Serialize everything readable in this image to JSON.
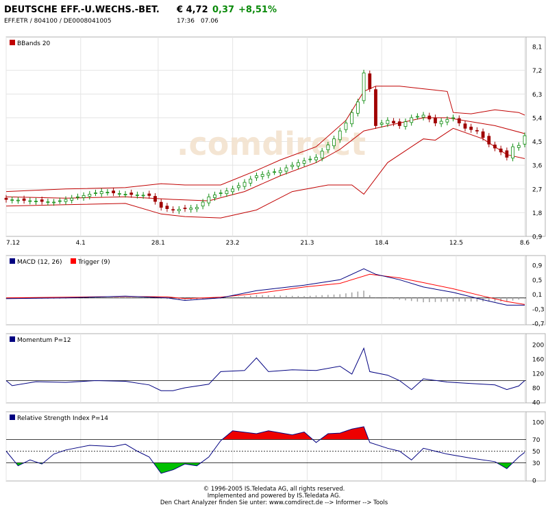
{
  "header": {
    "title": "DEUTSCHE EFF.-U.WECHS.-BET.",
    "price": "€ 4,72",
    "change": "0,37",
    "change_pct": "+8,51%",
    "ids": "EFF.ETR  /  804100  /  DE0008041005",
    "time": "17:36",
    "date": "07.06"
  },
  "colors": {
    "up_candle": "#0a8a0a",
    "down_candle": "#a00000",
    "bands": "#c00000",
    "macd": "#000080",
    "trigger": "#ff0000",
    "momentum": "#000080",
    "rsi": "#000080",
    "rsi_overbought": "#ee0000",
    "rsi_oversold": "#00c000",
    "panel_border": "#b0b0b0",
    "grid": "#e4e4e4"
  },
  "footer": {
    "line1": "© 1996-2005 IS.Teledata AG, all rights reserved.",
    "line2": "Implemented and powered by IS.Teledata AG.",
    "line3": "Den Chart Analyzer finden Sie unter: www.comdirect.de --> Informer --> Tools"
  },
  "watermark": ".comdirect",
  "chart_data": [
    {
      "type": "candlestick",
      "title": "BBands 20",
      "x_ticks": [
        "7.12",
        "4.1",
        "28.1",
        "23.2",
        "21.3",
        "18.4",
        "12.5",
        "8.6"
      ],
      "ylim": [
        0.9,
        8.1
      ],
      "y_ticks": [
        "8,1",
        "7,2",
        "6,3",
        "5,4",
        "4,5",
        "3,6",
        "2,7",
        "1,8",
        "0,9"
      ],
      "close_points": [
        {
          "x": 0,
          "y": 2.3
        },
        {
          "x": 4,
          "y": 2.25
        },
        {
          "x": 8,
          "y": 2.2
        },
        {
          "x": 12,
          "y": 2.4
        },
        {
          "x": 16,
          "y": 2.6
        },
        {
          "x": 20,
          "y": 2.5
        },
        {
          "x": 24,
          "y": 2.45
        },
        {
          "x": 26,
          "y": 2.0
        },
        {
          "x": 28,
          "y": 1.9
        },
        {
          "x": 32,
          "y": 2.0
        },
        {
          "x": 34,
          "y": 2.4
        },
        {
          "x": 38,
          "y": 2.7
        },
        {
          "x": 42,
          "y": 3.2
        },
        {
          "x": 46,
          "y": 3.4
        },
        {
          "x": 49,
          "y": 3.7
        },
        {
          "x": 52,
          "y": 3.9
        },
        {
          "x": 55,
          "y": 4.6
        },
        {
          "x": 57,
          "y": 5.2
        },
        {
          "x": 59,
          "y": 6.0
        },
        {
          "x": 60,
          "y": 7.1
        },
        {
          "x": 61,
          "y": 6.5
        },
        {
          "x": 62,
          "y": 5.1
        },
        {
          "x": 64,
          "y": 5.3
        },
        {
          "x": 66,
          "y": 5.1
        },
        {
          "x": 68,
          "y": 5.4
        },
        {
          "x": 70,
          "y": 5.5
        },
        {
          "x": 72,
          "y": 5.2
        },
        {
          "x": 75,
          "y": 5.4
        },
        {
          "x": 77,
          "y": 5.0
        },
        {
          "x": 79,
          "y": 4.9
        },
        {
          "x": 81,
          "y": 4.4
        },
        {
          "x": 83,
          "y": 4.1
        },
        {
          "x": 84,
          "y": 3.9
        },
        {
          "x": 85,
          "y": 4.3
        },
        {
          "x": 86,
          "y": 4.35
        },
        {
          "x": 87,
          "y": 4.72
        }
      ],
      "bband_upper": [
        {
          "x": 0,
          "y": 2.6
        },
        {
          "x": 10,
          "y": 2.7
        },
        {
          "x": 20,
          "y": 2.75
        },
        {
          "x": 26,
          "y": 2.9
        },
        {
          "x": 30,
          "y": 2.85
        },
        {
          "x": 36,
          "y": 2.85
        },
        {
          "x": 42,
          "y": 3.4
        },
        {
          "x": 46,
          "y": 3.8
        },
        {
          "x": 52,
          "y": 4.3
        },
        {
          "x": 57,
          "y": 5.3
        },
        {
          "x": 60,
          "y": 6.4
        },
        {
          "x": 62,
          "y": 6.6
        },
        {
          "x": 66,
          "y": 6.6
        },
        {
          "x": 70,
          "y": 6.5
        },
        {
          "x": 74,
          "y": 6.4
        },
        {
          "x": 75,
          "y": 5.6
        },
        {
          "x": 78,
          "y": 5.55
        },
        {
          "x": 82,
          "y": 5.7
        },
        {
          "x": 86,
          "y": 5.6
        },
        {
          "x": 87,
          "y": 5.5
        }
      ],
      "bband_middle": [
        {
          "x": 0,
          "y": 2.4
        },
        {
          "x": 10,
          "y": 2.35
        },
        {
          "x": 20,
          "y": 2.4
        },
        {
          "x": 28,
          "y": 2.3
        },
        {
          "x": 34,
          "y": 2.25
        },
        {
          "x": 40,
          "y": 2.6
        },
        {
          "x": 46,
          "y": 3.2
        },
        {
          "x": 52,
          "y": 3.7
        },
        {
          "x": 56,
          "y": 4.2
        },
        {
          "x": 60,
          "y": 4.9
        },
        {
          "x": 64,
          "y": 5.1
        },
        {
          "x": 70,
          "y": 5.4
        },
        {
          "x": 74,
          "y": 5.4
        },
        {
          "x": 78,
          "y": 5.25
        },
        {
          "x": 82,
          "y": 5.1
        },
        {
          "x": 87,
          "y": 4.8
        }
      ],
      "bband_lower": [
        {
          "x": 0,
          "y": 2.05
        },
        {
          "x": 10,
          "y": 2.1
        },
        {
          "x": 20,
          "y": 2.15
        },
        {
          "x": 26,
          "y": 1.75
        },
        {
          "x": 30,
          "y": 1.65
        },
        {
          "x": 36,
          "y": 1.6
        },
        {
          "x": 42,
          "y": 1.9
        },
        {
          "x": 48,
          "y": 2.6
        },
        {
          "x": 54,
          "y": 2.85
        },
        {
          "x": 58,
          "y": 2.85
        },
        {
          "x": 60,
          "y": 2.5
        },
        {
          "x": 64,
          "y": 3.7
        },
        {
          "x": 68,
          "y": 4.3
        },
        {
          "x": 70,
          "y": 4.6
        },
        {
          "x": 72,
          "y": 4.55
        },
        {
          "x": 75,
          "y": 5.0
        },
        {
          "x": 80,
          "y": 4.6
        },
        {
          "x": 84,
          "y": 4.0
        },
        {
          "x": 87,
          "y": 3.85
        }
      ]
    },
    {
      "type": "line",
      "title": "MACD (12, 26)",
      "legend": [
        "MACD (12, 26)",
        "Trigger (9)"
      ],
      "ylim": [
        -0.7,
        0.9
      ],
      "y_ticks": [
        "0,9",
        "0,5",
        "0,1",
        "-0,3",
        "-0,7"
      ],
      "series": [
        {
          "name": "MACD (12, 26)",
          "points": [
            {
              "x": 0,
              "y": -0.02
            },
            {
              "x": 10,
              "y": 0.0
            },
            {
              "x": 20,
              "y": 0.05
            },
            {
              "x": 27,
              "y": 0.0
            },
            {
              "x": 30,
              "y": -0.07
            },
            {
              "x": 36,
              "y": 0.0
            },
            {
              "x": 42,
              "y": 0.2
            },
            {
              "x": 50,
              "y": 0.35
            },
            {
              "x": 56,
              "y": 0.5
            },
            {
              "x": 60,
              "y": 0.8
            },
            {
              "x": 62,
              "y": 0.65
            },
            {
              "x": 66,
              "y": 0.5
            },
            {
              "x": 70,
              "y": 0.3
            },
            {
              "x": 75,
              "y": 0.15
            },
            {
              "x": 80,
              "y": -0.05
            },
            {
              "x": 84,
              "y": -0.2
            },
            {
              "x": 87,
              "y": -0.2
            }
          ]
        },
        {
          "name": "Trigger (9)",
          "points": [
            {
              "x": 0,
              "y": 0.0
            },
            {
              "x": 10,
              "y": 0.02
            },
            {
              "x": 20,
              "y": 0.04
            },
            {
              "x": 27,
              "y": 0.03
            },
            {
              "x": 30,
              "y": -0.02
            },
            {
              "x": 36,
              "y": 0.02
            },
            {
              "x": 42,
              "y": 0.12
            },
            {
              "x": 50,
              "y": 0.3
            },
            {
              "x": 56,
              "y": 0.4
            },
            {
              "x": 61,
              "y": 0.65
            },
            {
              "x": 66,
              "y": 0.55
            },
            {
              "x": 70,
              "y": 0.42
            },
            {
              "x": 75,
              "y": 0.25
            },
            {
              "x": 80,
              "y": 0.05
            },
            {
              "x": 84,
              "y": -0.1
            },
            {
              "x": 87,
              "y": -0.18
            }
          ]
        }
      ]
    },
    {
      "type": "line",
      "title": "Momentum P=12",
      "ylim": [
        40,
        200
      ],
      "y_ticks": [
        "200",
        "160",
        "120",
        "80",
        "40"
      ],
      "reference_line": 100,
      "points": [
        {
          "x": 0,
          "y": 100
        },
        {
          "x": 1,
          "y": 86
        },
        {
          "x": 5,
          "y": 97
        },
        {
          "x": 10,
          "y": 95
        },
        {
          "x": 15,
          "y": 100
        },
        {
          "x": 20,
          "y": 98
        },
        {
          "x": 24,
          "y": 88
        },
        {
          "x": 26,
          "y": 72
        },
        {
          "x": 28,
          "y": 72
        },
        {
          "x": 30,
          "y": 80
        },
        {
          "x": 34,
          "y": 90
        },
        {
          "x": 36,
          "y": 125
        },
        {
          "x": 40,
          "y": 128
        },
        {
          "x": 42,
          "y": 163
        },
        {
          "x": 44,
          "y": 125
        },
        {
          "x": 48,
          "y": 130
        },
        {
          "x": 52,
          "y": 128
        },
        {
          "x": 56,
          "y": 140
        },
        {
          "x": 58,
          "y": 118
        },
        {
          "x": 60,
          "y": 190
        },
        {
          "x": 61,
          "y": 125
        },
        {
          "x": 64,
          "y": 115
        },
        {
          "x": 66,
          "y": 100
        },
        {
          "x": 68,
          "y": 75
        },
        {
          "x": 70,
          "y": 105
        },
        {
          "x": 74,
          "y": 96
        },
        {
          "x": 78,
          "y": 92
        },
        {
          "x": 82,
          "y": 88
        },
        {
          "x": 84,
          "y": 75
        },
        {
          "x": 86,
          "y": 85
        },
        {
          "x": 87,
          "y": 100
        }
      ]
    },
    {
      "type": "line",
      "title": "Relative Strength Index P=14",
      "ylim": [
        0,
        100
      ],
      "y_ticks": [
        "100",
        "70",
        "50",
        "30",
        "0"
      ],
      "overbought": 70,
      "oversold": 30,
      "points": [
        {
          "x": 0,
          "y": 50
        },
        {
          "x": 2,
          "y": 25
        },
        {
          "x": 4,
          "y": 35
        },
        {
          "x": 6,
          "y": 28
        },
        {
          "x": 8,
          "y": 45
        },
        {
          "x": 10,
          "y": 52
        },
        {
          "x": 14,
          "y": 60
        },
        {
          "x": 18,
          "y": 58
        },
        {
          "x": 20,
          "y": 62
        },
        {
          "x": 22,
          "y": 50
        },
        {
          "x": 24,
          "y": 40
        },
        {
          "x": 26,
          "y": 12
        },
        {
          "x": 28,
          "y": 18
        },
        {
          "x": 30,
          "y": 28
        },
        {
          "x": 32,
          "y": 25
        },
        {
          "x": 34,
          "y": 40
        },
        {
          "x": 36,
          "y": 68
        },
        {
          "x": 38,
          "y": 85
        },
        {
          "x": 42,
          "y": 80
        },
        {
          "x": 44,
          "y": 85
        },
        {
          "x": 48,
          "y": 78
        },
        {
          "x": 50,
          "y": 83
        },
        {
          "x": 52,
          "y": 65
        },
        {
          "x": 54,
          "y": 80
        },
        {
          "x": 56,
          "y": 81
        },
        {
          "x": 58,
          "y": 88
        },
        {
          "x": 60,
          "y": 92
        },
        {
          "x": 61,
          "y": 65
        },
        {
          "x": 64,
          "y": 55
        },
        {
          "x": 66,
          "y": 50
        },
        {
          "x": 68,
          "y": 35
        },
        {
          "x": 70,
          "y": 55
        },
        {
          "x": 74,
          "y": 45
        },
        {
          "x": 78,
          "y": 38
        },
        {
          "x": 82,
          "y": 32
        },
        {
          "x": 84,
          "y": 20
        },
        {
          "x": 86,
          "y": 40
        },
        {
          "x": 87,
          "y": 48
        }
      ]
    }
  ]
}
